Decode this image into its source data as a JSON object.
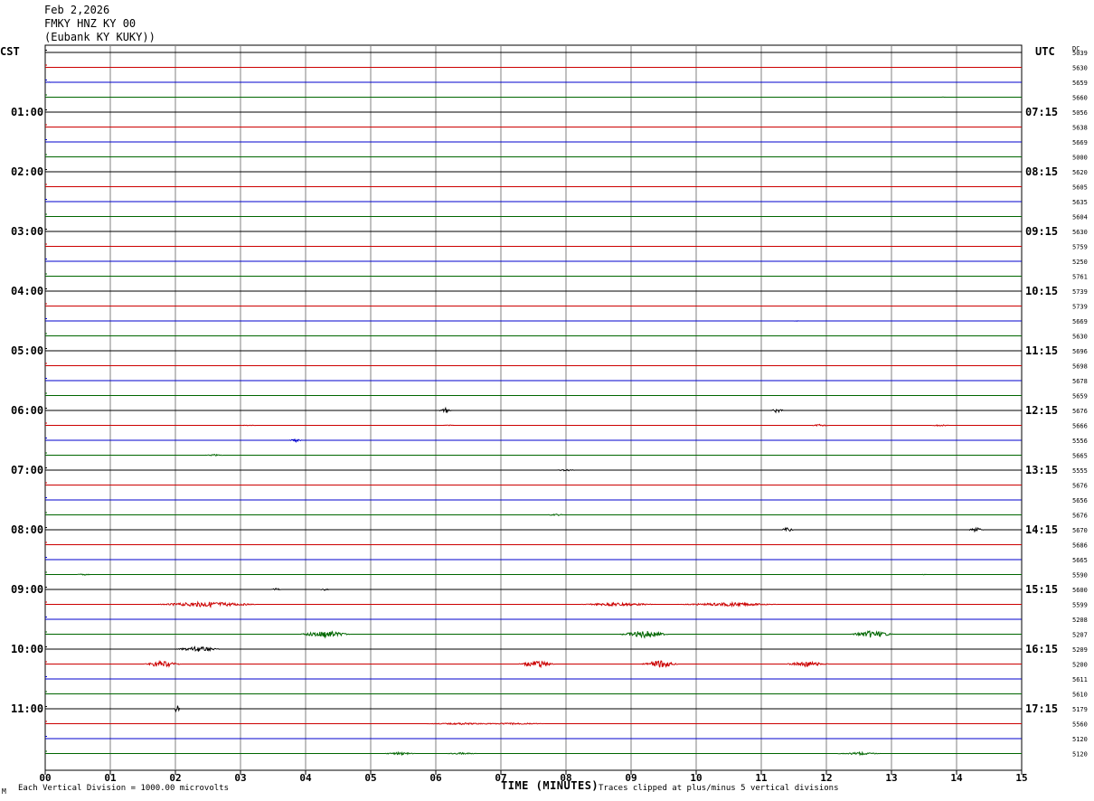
{
  "header": {
    "date": "Feb 2,2026",
    "station": "FMKY HNZ KY 00",
    "location": "(Eubank KY KUKY))"
  },
  "timezones": {
    "left": "CST",
    "right": "UTC"
  },
  "dc_header": "DC",
  "footer": {
    "division": "Each Vertical Division = 1000.00 microvolts",
    "clipping": "Traces clipped at plus/minus 5 vertical divisions",
    "corner": "M"
  },
  "colors": {
    "trace_cycle": [
      "#000000",
      "#cc0000",
      "#0000cc",
      "#006600"
    ],
    "grid": "#808080"
  },
  "chart_data": {
    "type": "line",
    "title": "",
    "xlabel": "TIME (MINUTES)",
    "ylabel": "",
    "xlim": [
      0,
      15
    ],
    "x_ticks": [
      "00",
      "01",
      "02",
      "03",
      "04",
      "05",
      "06",
      "07",
      "08",
      "09",
      "10",
      "11",
      "12",
      "13",
      "14",
      "15"
    ],
    "trace_minutes": 15,
    "num_traces": 48,
    "left_hour_labels": [
      "01:00",
      "02:00",
      "03:00",
      "04:00",
      "05:00",
      "06:00",
      "07:00",
      "08:00",
      "09:00",
      "10:00",
      "11:00"
    ],
    "right_hour_labels": [
      "07:15",
      "08:15",
      "09:15",
      "10:15",
      "11:15",
      "12:15",
      "13:15",
      "14:15",
      "15:15",
      "16:15",
      "17:15"
    ],
    "dc_offsets": [
      "5039",
      "5630",
      "5659",
      "5660",
      "5056",
      "5638",
      "5669",
      "5000",
      "5620",
      "5605",
      "5635",
      "5604",
      "5630",
      "5759",
      "5250",
      "5761",
      "5739",
      "5739",
      "5669",
      "5630",
      "5696",
      "5698",
      "5678",
      "5659",
      "5676",
      "5666",
      "5556",
      "5665",
      "5555",
      "5676",
      "5656",
      "5676",
      "5670",
      "5686",
      "5665",
      "5590",
      "5600",
      "5599",
      "5208",
      "5207",
      "5209",
      "5200",
      "5611",
      "5610",
      "5179",
      "5560",
      "5120",
      "5120"
    ],
    "events": [
      {
        "trace": 2,
        "minute": 0.05,
        "amplitude": 0.3,
        "width": 0.05
      },
      {
        "trace": 3,
        "minute": 13.8,
        "amplitude": 0.3,
        "width": 0.05
      },
      {
        "trace": 18,
        "minute": 11.55,
        "amplitude": 0.3,
        "width": 0.05
      },
      {
        "trace": 24,
        "minute": 6.15,
        "amplitude": 3.0,
        "width": 0.1
      },
      {
        "trace": 24,
        "minute": 11.25,
        "amplitude": 3.0,
        "width": 0.1
      },
      {
        "trace": 25,
        "minute": 3.1,
        "amplitude": 0.3,
        "width": 0.2
      },
      {
        "trace": 25,
        "minute": 6.2,
        "amplitude": 0.6,
        "width": 0.1
      },
      {
        "trace": 25,
        "minute": 11.9,
        "amplitude": 1.2,
        "width": 0.15
      },
      {
        "trace": 25,
        "minute": 13.75,
        "amplitude": 1.0,
        "width": 0.15
      },
      {
        "trace": 26,
        "minute": 3.85,
        "amplitude": 2.0,
        "width": 0.1
      },
      {
        "trace": 27,
        "minute": 2.6,
        "amplitude": 1.0,
        "width": 0.15
      },
      {
        "trace": 28,
        "minute": 8.0,
        "amplitude": 1.0,
        "width": 0.15
      },
      {
        "trace": 31,
        "minute": 7.85,
        "amplitude": 1.0,
        "width": 0.15
      },
      {
        "trace": 32,
        "minute": 11.4,
        "amplitude": 2.5,
        "width": 0.1
      },
      {
        "trace": 32,
        "minute": 14.3,
        "amplitude": 2.5,
        "width": 0.12
      },
      {
        "trace": 35,
        "minute": 0.6,
        "amplitude": 1.0,
        "width": 0.12
      },
      {
        "trace": 35,
        "minute": 13.5,
        "amplitude": 0.5,
        "width": 0.05
      },
      {
        "trace": 36,
        "minute": 3.55,
        "amplitude": 1.5,
        "width": 0.08
      },
      {
        "trace": 36,
        "minute": 4.3,
        "amplitude": 1.2,
        "width": 0.08
      },
      {
        "trace": 37,
        "minute": 2.5,
        "amplitude": 3.0,
        "width": 0.8
      },
      {
        "trace": 37,
        "minute": 8.8,
        "amplitude": 2.0,
        "width": 0.6
      },
      {
        "trace": 37,
        "minute": 10.5,
        "amplitude": 2.0,
        "width": 0.8
      },
      {
        "trace": 39,
        "minute": 4.3,
        "amplitude": 4.0,
        "width": 0.4
      },
      {
        "trace": 39,
        "minute": 9.2,
        "amplitude": 4.0,
        "width": 0.4
      },
      {
        "trace": 39,
        "minute": 12.7,
        "amplitude": 4.0,
        "width": 0.35
      },
      {
        "trace": 40,
        "minute": 2.35,
        "amplitude": 3.0,
        "width": 0.35
      },
      {
        "trace": 41,
        "minute": 1.8,
        "amplitude": 4.0,
        "width": 0.3
      },
      {
        "trace": 41,
        "minute": 7.55,
        "amplitude": 4.0,
        "width": 0.3
      },
      {
        "trace": 41,
        "minute": 9.45,
        "amplitude": 4.0,
        "width": 0.3
      },
      {
        "trace": 41,
        "minute": 11.7,
        "amplitude": 3.0,
        "width": 0.35
      },
      {
        "trace": 44,
        "minute": 2.02,
        "amplitude": 5.0,
        "width": 0.05
      },
      {
        "trace": 45,
        "minute": 6.4,
        "amplitude": 1.0,
        "width": 0.6
      },
      {
        "trace": 45,
        "minute": 7.2,
        "amplitude": 1.0,
        "width": 0.5
      },
      {
        "trace": 47,
        "minute": 5.45,
        "amplitude": 1.5,
        "width": 0.25
      },
      {
        "trace": 47,
        "minute": 6.4,
        "amplitude": 1.2,
        "width": 0.25
      },
      {
        "trace": 47,
        "minute": 12.5,
        "amplitude": 1.5,
        "width": 0.35
      }
    ]
  }
}
